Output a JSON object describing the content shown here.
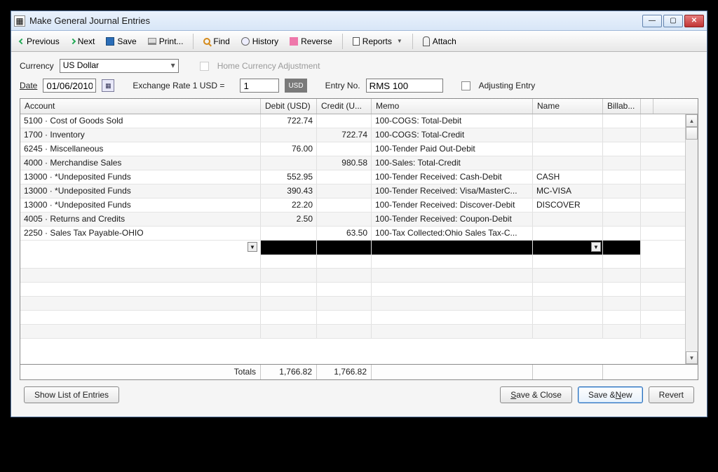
{
  "window": {
    "title": "Make General Journal Entries"
  },
  "toolbar": {
    "previous": "Previous",
    "next": "Next",
    "save": "Save",
    "print": "Print...",
    "find": "Find",
    "history": "History",
    "reverse": "Reverse",
    "reports": "Reports",
    "attach": "Attach"
  },
  "form": {
    "currency_label": "Currency",
    "currency_value": "US Dollar",
    "home_currency_label": "Home Currency Adjustment",
    "date_label": "Date",
    "date_value": "01/06/2010",
    "exchange_label": "Exchange Rate 1 USD =",
    "exchange_value": "1",
    "usd_btn": "USD",
    "entry_no_label": "Entry No.",
    "entry_no_value": "RMS 100",
    "adjusting_label": "Adjusting Entry"
  },
  "grid": {
    "headers": {
      "account": "Account",
      "debit": "Debit (USD)",
      "credit": "Credit (U...",
      "memo": "Memo",
      "name": "Name",
      "billable": "Billab..."
    },
    "rows": [
      {
        "account": "5100 · Cost of Goods Sold",
        "debit": "722.74",
        "credit": "",
        "memo": "100-COGS: Total-Debit",
        "name": ""
      },
      {
        "account": "1700 · Inventory",
        "debit": "",
        "credit": "722.74",
        "memo": "100-COGS: Total-Credit",
        "name": ""
      },
      {
        "account": "6245 · Miscellaneous",
        "debit": "76.00",
        "credit": "",
        "memo": "100-Tender Paid Out-Debit",
        "name": ""
      },
      {
        "account": "4000 · Merchandise Sales",
        "debit": "",
        "credit": "980.58",
        "memo": "100-Sales: Total-Credit",
        "name": ""
      },
      {
        "account": "13000 · *Undeposited Funds",
        "debit": "552.95",
        "credit": "",
        "memo": "100-Tender Received: Cash-Debit",
        "name": "CASH"
      },
      {
        "account": "13000 · *Undeposited Funds",
        "debit": "390.43",
        "credit": "",
        "memo": "100-Tender Received: Visa/MasterC...",
        "name": "MC-VISA"
      },
      {
        "account": "13000 · *Undeposited Funds",
        "debit": "22.20",
        "credit": "",
        "memo": "100-Tender Received: Discover-Debit",
        "name": "DISCOVER"
      },
      {
        "account": "4005 · Returns and Credits",
        "debit": "2.50",
        "credit": "",
        "memo": "100-Tender Received: Coupon-Debit",
        "name": ""
      },
      {
        "account": "2250 · Sales Tax Payable-OHIO",
        "debit": "",
        "credit": "63.50",
        "memo": "100-Tax Collected:Ohio Sales Tax-C...",
        "name": ""
      }
    ],
    "blank_rows": 6,
    "totals_label": "Totals",
    "total_debit": "1,766.82",
    "total_credit": "1,766.82"
  },
  "footer": {
    "show_list": "Show List of Entries",
    "save_close": "Save & Close",
    "save_new": "Save & New",
    "revert": "Revert"
  }
}
